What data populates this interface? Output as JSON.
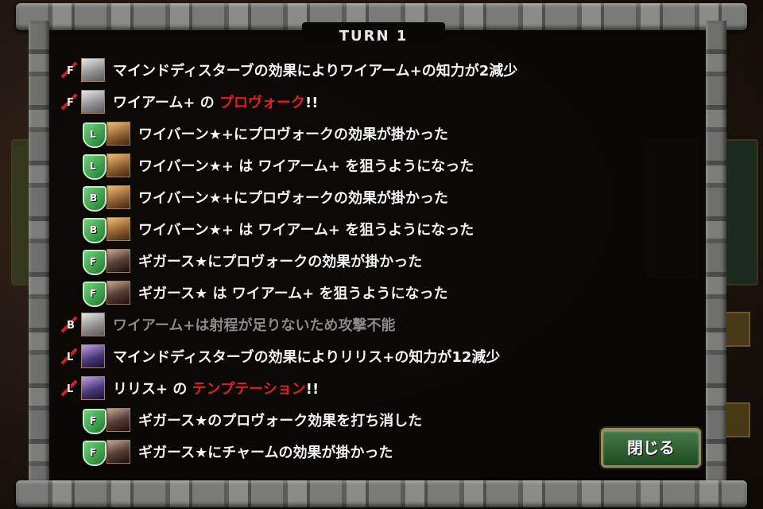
{
  "turn_label": "TURN   1",
  "close_label": "閉じる",
  "colors": {
    "highlight": "#e02020",
    "text": "#f4f4f4",
    "dim": "#8a8a8a"
  },
  "log": [
    {
      "type": "attack",
      "letter": "F",
      "portrait": "wyarm",
      "indent": false,
      "dim": false,
      "pre": "マインドディスターブの効果によりワイアーム+の知力が2減少",
      "hl": "",
      "post": ""
    },
    {
      "type": "attack",
      "letter": "F",
      "portrait": "wyarm",
      "indent": false,
      "dim": false,
      "pre": "ワイアーム+ の ",
      "hl": "プロヴォーク",
      "post": "!!"
    },
    {
      "type": "shield",
      "letter": "L",
      "portrait": "wyvern",
      "indent": true,
      "dim": false,
      "pre": "ワイバーン★+にプロヴォークの効果が掛かった",
      "hl": "",
      "post": ""
    },
    {
      "type": "shield",
      "letter": "L",
      "portrait": "wyvern",
      "indent": true,
      "dim": false,
      "pre": "ワイバーン★+ は ワイアーム+ を狙うようになった",
      "hl": "",
      "post": ""
    },
    {
      "type": "shield",
      "letter": "B",
      "portrait": "wyvern",
      "indent": true,
      "dim": false,
      "pre": "ワイバーン★+にプロヴォークの効果が掛かった",
      "hl": "",
      "post": ""
    },
    {
      "type": "shield",
      "letter": "B",
      "portrait": "wyvern",
      "indent": true,
      "dim": false,
      "pre": "ワイバーン★+ は ワイアーム+ を狙うようになった",
      "hl": "",
      "post": ""
    },
    {
      "type": "shield",
      "letter": "F",
      "portrait": "gigas",
      "indent": true,
      "dim": false,
      "pre": "ギガース★にプロヴォークの効果が掛かった",
      "hl": "",
      "post": ""
    },
    {
      "type": "shield",
      "letter": "F",
      "portrait": "gigas",
      "indent": true,
      "dim": false,
      "pre": "ギガース★ は ワイアーム+ を狙うようになった",
      "hl": "",
      "post": ""
    },
    {
      "type": "attack",
      "letter": "B",
      "portrait": "wyarm",
      "indent": false,
      "dim": true,
      "pre": "ワイアーム+は射程が足りないため攻撃不能",
      "hl": "",
      "post": ""
    },
    {
      "type": "attack",
      "letter": "L",
      "portrait": "lilith",
      "indent": false,
      "dim": false,
      "pre": "マインドディスターブの効果によりリリス+の知力が12減少",
      "hl": "",
      "post": ""
    },
    {
      "type": "attack",
      "letter": "L",
      "portrait": "lilith",
      "indent": false,
      "dim": false,
      "pre": "リリス+ の ",
      "hl": "テンプテーション",
      "post": "!!"
    },
    {
      "type": "shield",
      "letter": "F",
      "portrait": "gigas",
      "indent": true,
      "dim": false,
      "pre": "ギガース★のプロヴォーク効果を打ち消した",
      "hl": "",
      "post": ""
    },
    {
      "type": "shield",
      "letter": "F",
      "portrait": "gigas",
      "indent": true,
      "dim": false,
      "pre": "ギガース★にチャームの効果が掛かった",
      "hl": "",
      "post": ""
    }
  ]
}
